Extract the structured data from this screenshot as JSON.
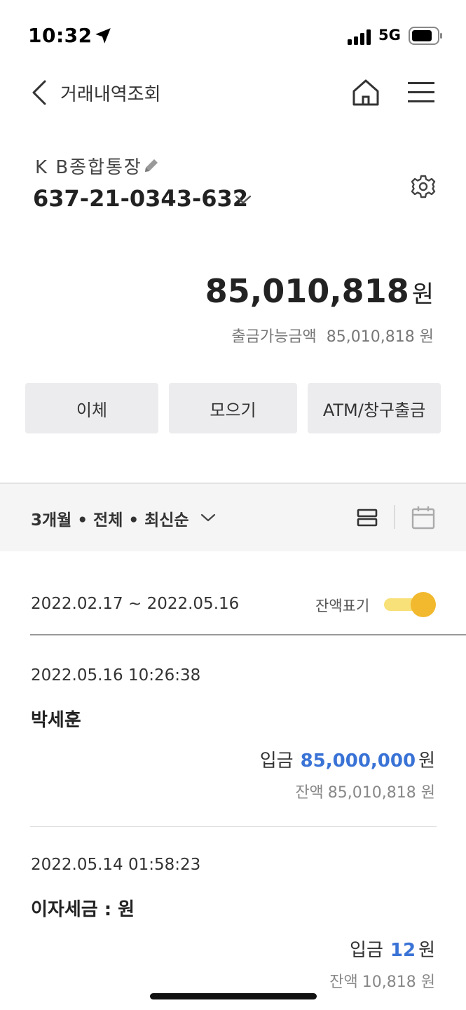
{
  "status_bar": {
    "time": "10:32",
    "network": "5G"
  },
  "nav": {
    "title": "거래내역조회"
  },
  "account": {
    "name": "K B종합통장",
    "number": "637-21-0343-632"
  },
  "balance": {
    "amount": "85,010,818",
    "unit": "원",
    "available_label": "출금가능금액",
    "available_amount": "85,010,818 원"
  },
  "actions": [
    {
      "label": "이체"
    },
    {
      "label": "모으기"
    },
    {
      "label": "ATM/창구출금"
    }
  ],
  "filter": {
    "label": "3개월 • 전체 • 최신순"
  },
  "range": {
    "dates": "2022.02.17 ~ 2022.05.16",
    "toggle_label": "잔액표기",
    "toggle_on": true
  },
  "transactions": [
    {
      "time": "2022.05.16 10:26:38",
      "name": "박세훈",
      "type": "입금",
      "amount": "85,000,000",
      "unit": "원",
      "balance_label": "잔액",
      "balance": "85,010,818 원"
    },
    {
      "time": "2022.05.14 01:58:23",
      "name": "이자세금 : 원",
      "type": "입금",
      "amount": "12",
      "unit": "원",
      "balance_label": "잔액",
      "balance": "10,818 원"
    }
  ],
  "colors": {
    "accent_blue": "#3a73d6",
    "toggle_knob": "#f2b92e",
    "toggle_track": "#f7e178",
    "button_bg": "#ececee"
  }
}
